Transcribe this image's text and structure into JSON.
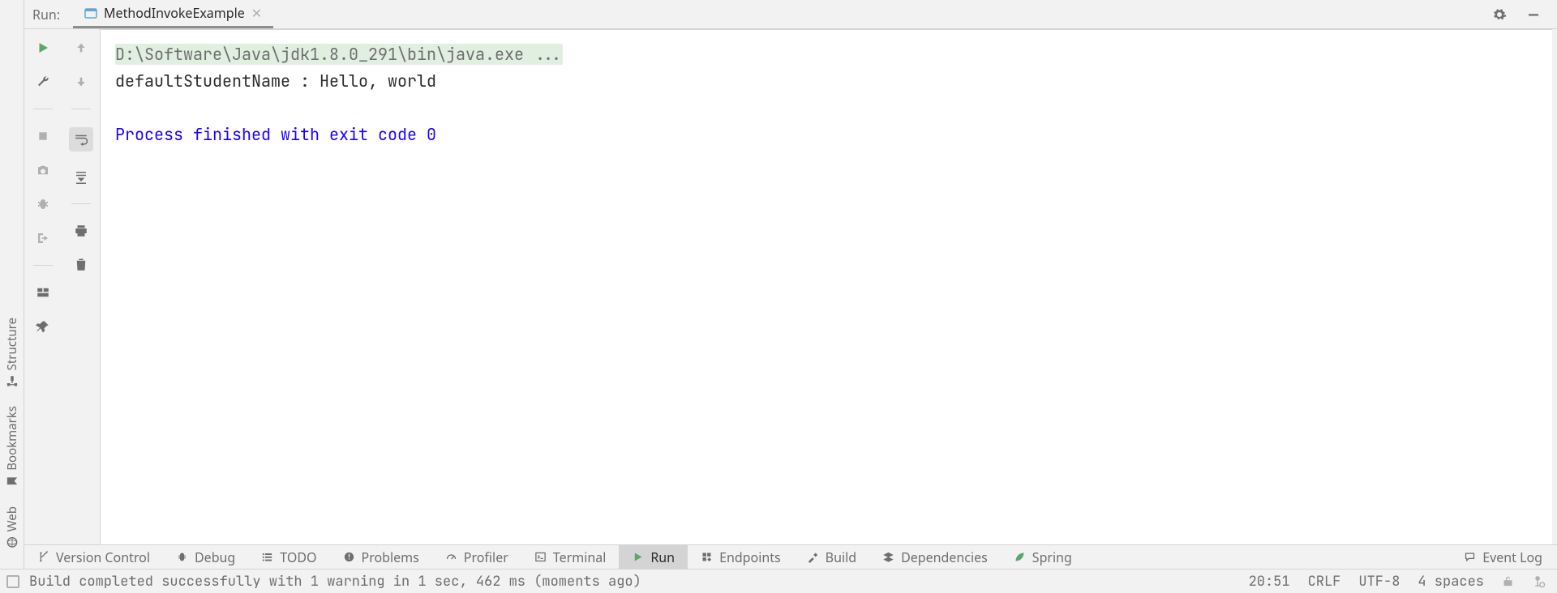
{
  "run_panel": {
    "title": "Run:",
    "tabs": [
      {
        "label": "MethodInvokeExample",
        "icon": "app-icon"
      }
    ]
  },
  "console": {
    "command": "D:\\Software\\Java\\jdk1.8.0_291\\bin\\java.exe ...",
    "output_lines": [
      "defaultStudentName : Hello, world"
    ],
    "exit_line": "Process finished with exit code 0"
  },
  "left_tool_windows": [
    {
      "id": "structure",
      "label": "Structure",
      "icon": "structure-icon"
    },
    {
      "id": "bookmarks",
      "label": "Bookmarks",
      "icon": "bookmark-icon"
    },
    {
      "id": "web",
      "label": "Web",
      "icon": "globe-icon"
    }
  ],
  "bottom_tool_windows": [
    {
      "id": "vcs",
      "label": "Version Control",
      "icon": "branch-icon"
    },
    {
      "id": "debug",
      "label": "Debug",
      "icon": "bug-icon"
    },
    {
      "id": "todo",
      "label": "TODO",
      "icon": "list-icon"
    },
    {
      "id": "problems",
      "label": "Problems",
      "icon": "warn-icon"
    },
    {
      "id": "profiler",
      "label": "Profiler",
      "icon": "gauge-icon"
    },
    {
      "id": "terminal",
      "label": "Terminal",
      "icon": "terminal-icon"
    },
    {
      "id": "run",
      "label": "Run",
      "icon": "play-icon",
      "selected": true
    },
    {
      "id": "endpoints",
      "label": "Endpoints",
      "icon": "endpoints-icon"
    },
    {
      "id": "build",
      "label": "Build",
      "icon": "hammer-icon"
    },
    {
      "id": "deps",
      "label": "Dependencies",
      "icon": "layers-icon"
    },
    {
      "id": "spring",
      "label": "Spring",
      "icon": "leaf-icon"
    }
  ],
  "bottom_right": {
    "event_log_label": "Event Log"
  },
  "statusbar": {
    "message": "Build completed successfully with 1 warning in 1 sec, 462 ms (moments ago)",
    "clock": "20:51",
    "line_sep": "CRLF",
    "encoding": "UTF-8",
    "indent": "4 spaces"
  }
}
